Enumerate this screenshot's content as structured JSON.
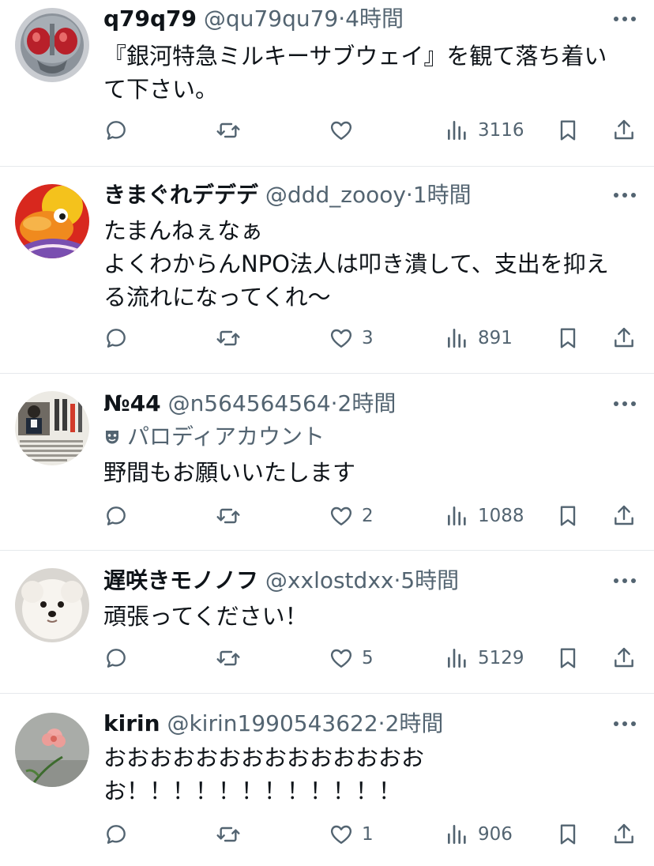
{
  "posts": [
    {
      "name": "q79q79",
      "handle": "@qu79qu79",
      "sep": "·",
      "time": "4時間",
      "label": "",
      "lines": [
        "『銀河特急ミルキーサブウェイ』を観て落ち着い",
        "て下さい。"
      ],
      "likes": "",
      "views": "3116",
      "avatar_icon": "masked-hero-avatar"
    },
    {
      "name": "きまぐれデデデ",
      "handle": "@ddd_zoooy",
      "sep": "·",
      "time": "1時間",
      "label": "",
      "lines": [
        "たまんねぇなぁ",
        "よくわからんNPO法人は叩き潰して、支出を抑え",
        "る流れになってくれ〜"
      ],
      "likes": "3",
      "views": "891",
      "avatar_icon": "cartoon-duck-avatar"
    },
    {
      "name": "№44",
      "handle": "@n564564564",
      "sep": "·",
      "time": "2時間",
      "label": "パロディアカウント",
      "lines": [
        "野間もお願いいたします"
      ],
      "likes": "2",
      "views": "1088",
      "avatar_icon": "newspaper-clipping-avatar"
    },
    {
      "name": "遅咲きモノノフ",
      "handle": "@xxlostdxx",
      "sep": "·",
      "time": "5時間",
      "label": "",
      "lines": [
        "頑張ってください！"
      ],
      "likes": "5",
      "views": "5129",
      "avatar_icon": "white-dog-avatar"
    },
    {
      "name": "kirin",
      "handle": "@kirin1990543622",
      "sep": "·",
      "time": "2時間",
      "label": "",
      "lines": [
        "おおおおおおおおおおおおおお",
        "お！！！！！！！！！！！！"
      ],
      "likes": "1",
      "views": "906",
      "avatar_icon": "pink-flower-avatar"
    }
  ],
  "colors": {
    "text": "#0f1419",
    "muted": "#536471",
    "divider": "#e6e9ec"
  }
}
